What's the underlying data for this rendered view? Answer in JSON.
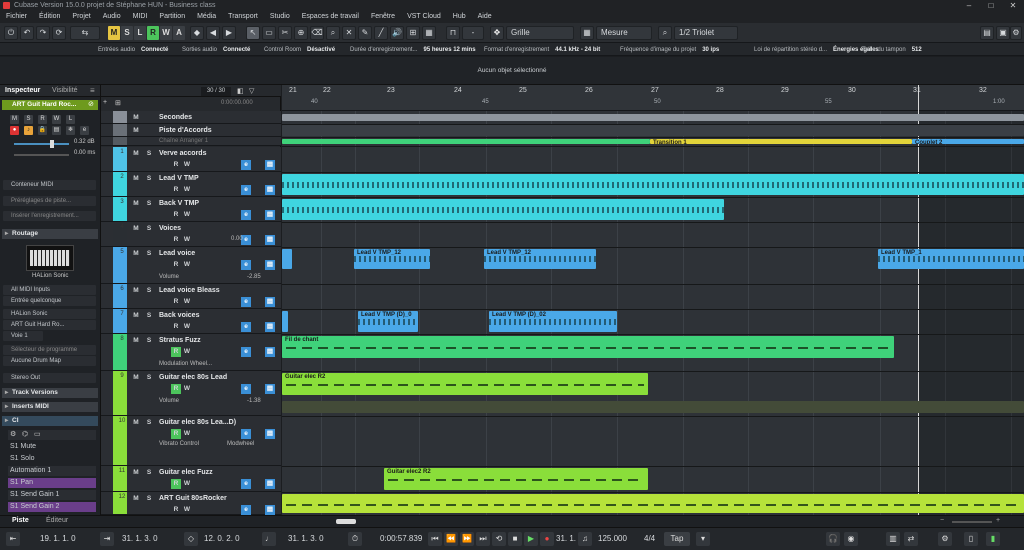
{
  "window": {
    "title": "Cubase Version 15.0.0 projet de Stéphane HUN - Business class"
  },
  "menu": [
    "Fichier",
    "Édition",
    "Projet",
    "Audio",
    "MIDI",
    "Partition",
    "Média",
    "Transport",
    "Studio",
    "Espaces de travail",
    "Fenêtre",
    "VST Cloud",
    "Hub",
    "Aide"
  ],
  "toolbar": {
    "modes": [
      "M",
      "S",
      "L",
      "R",
      "W",
      "A"
    ],
    "snap": "Grille",
    "snap_unit": "Mesure",
    "quantize": "1/2 Triolet",
    "dash": "-"
  },
  "status": [
    {
      "label": "Entrées audio",
      "value": "Connecté"
    },
    {
      "label": "Sorties audio",
      "value": "Connecté"
    },
    {
      "label": "Control Room",
      "value": "Désactivé"
    },
    {
      "label": "Durée d'enregistrement...",
      "value": "95 heures 12 mins"
    },
    {
      "label": "Format d'enregistrement",
      "value": "44.1 kHz - 24 bit"
    },
    {
      "label": "Fréquence d'image du projet",
      "value": "30 ips"
    },
    {
      "label": "Loi de répartition stéréo d...",
      "value": "Énergies égales"
    },
    {
      "label": "Taille du tampon",
      "value": "512"
    }
  ],
  "info_line": "Aucun objet sélectionné",
  "inspector": {
    "tabs": [
      "Inspecteur",
      "Visibilité"
    ],
    "track_name": "ART Guit Hard Roc...",
    "volume": "0.32 dB",
    "delay": "0.00 ms",
    "midi_container": "Conteneur MIDI",
    "presets": "Préréglages de piste...",
    "insert": "Insérer l'enregistrement...",
    "routing_title": "Routage",
    "instrument": "HALion Sonic",
    "inputs": "All MIDI Inputs",
    "input_any": "Entrée quelconque",
    "out1": "HALion Sonic",
    "out2": "ART Guit Hard Ro...",
    "voice": "Voie 1",
    "program": "Sélecteur de programme",
    "drum_map": "Aucune Drum Map",
    "stereo_out": "Stereo Out",
    "sections": [
      "Track Versions",
      "Inserts MIDI",
      "CI"
    ],
    "ci_items": [
      "S1 Mute",
      "S1 Solo",
      "Automation 1",
      "S1 Pan",
      "S1 Send Gain 1",
      "S1 Send Gain 2"
    ],
    "bottom_tabs": [
      "Piste",
      "Éditeur"
    ]
  },
  "tracklist": {
    "counter": "30 / 30",
    "time_readout": "0:00:00.000",
    "tracks": [
      {
        "num": "",
        "name": "Secondes",
        "color": "#8a9099"
      },
      {
        "num": "",
        "name": "Piste d'Accords",
        "color": "#6a7078"
      },
      {
        "num": "",
        "name": "Chaîne Arranger 1",
        "color": "#555b62"
      },
      {
        "num": "1",
        "name": "Verve accords",
        "color": "#4fc3e8"
      },
      {
        "num": "2",
        "name": "Lead V TMP",
        "color": "#3fd5df"
      },
      {
        "num": "3",
        "name": "Back V TMP",
        "color": "#3fd5df"
      },
      {
        "num": "4",
        "name": "Voices",
        "color": "#2a2e33"
      },
      {
        "num": "5",
        "name": "Lead voice",
        "color": "#4aa8e8"
      },
      {
        "num": "6",
        "name": "Lead voice Bleass",
        "color": "#4aa8e8"
      },
      {
        "num": "7",
        "name": "Back voices",
        "color": "#4aa8e8"
      },
      {
        "num": "8",
        "name": "Stratus Fuzz",
        "color": "#3fd27a"
      },
      {
        "num": "9",
        "name": "Guitar elec 80s Lead",
        "color": "#8ade3a"
      },
      {
        "num": "10",
        "name": "Guitar elec 80s Lea...D)",
        "color": "#8ade3a"
      },
      {
        "num": "11",
        "name": "Guitar elec Fuzz",
        "color": "#8ade3a"
      },
      {
        "num": "12",
        "name": "ART Guit 80sRocker",
        "color": "#8ade3a"
      }
    ],
    "lead_voice_volume": "-2.85",
    "voices_value": "0.00",
    "mod_wheel": "Modulation Wheel...",
    "volume_label": "Volume",
    "vol_9": "-1.38",
    "vibrato": "Vibrato Control",
    "modwheel": "Modwheel"
  },
  "ruler": {
    "bars": [
      "21",
      "22",
      "23",
      "24",
      "25",
      "26",
      "27",
      "28",
      "29",
      "30",
      "31",
      "32"
    ],
    "seconds": [
      "40",
      "45",
      "50",
      "55",
      "1:00"
    ]
  },
  "clips": {
    "transition": "Transition 1",
    "couplet": "Couplet 2",
    "lead_a": "Lead V TMP_12",
    "lead_b": "Lead V TMP_12",
    "lead_c": "Lead V TMP_1",
    "back_a": "Lead V TMP (D)_0",
    "back_b": "Lead V TMP (D)_02",
    "fil": "Fil de chant",
    "gtr_r2": "Guitar elec R2",
    "gtr2_r2": "Guitar elec2 R2"
  },
  "transport": {
    "left_locator": "19. 1. 1.  0",
    "right_locator": "31. 1. 3.  0",
    "punch": "12. 0. 2.  0",
    "pos2": "31. 1. 3.  0",
    "time": "0:00:57.839",
    "bars_pos": "31. 1. 3.  0",
    "tempo": "125.000",
    "signature": "4/4",
    "tap": "Tap"
  }
}
